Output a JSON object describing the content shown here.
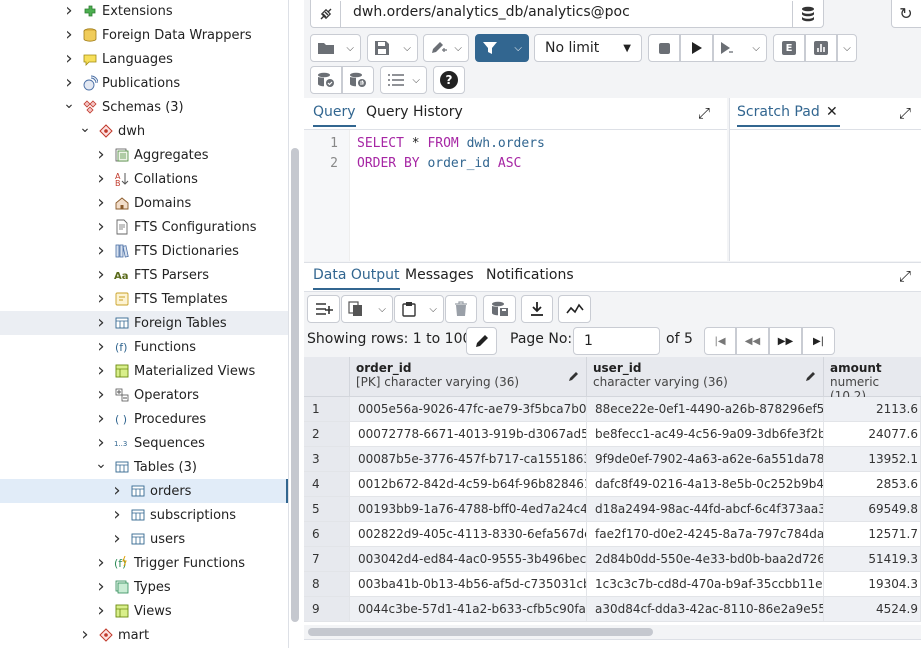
{
  "tree": {
    "items": [
      {
        "label": "Extensions",
        "count": ""
      },
      {
        "label": "Foreign Data Wrappers",
        "count": ""
      },
      {
        "label": "Languages",
        "count": ""
      },
      {
        "label": "Publications",
        "count": ""
      },
      {
        "label": "Schemas",
        "count": "(3)"
      },
      {
        "label": "dwh",
        "count": ""
      },
      {
        "label": "Aggregates",
        "count": ""
      },
      {
        "label": "Collations",
        "count": ""
      },
      {
        "label": "Domains",
        "count": ""
      },
      {
        "label": "FTS Configurations",
        "count": ""
      },
      {
        "label": "FTS Dictionaries",
        "count": ""
      },
      {
        "label": "FTS Parsers",
        "count": ""
      },
      {
        "label": "FTS Templates",
        "count": ""
      },
      {
        "label": "Foreign Tables",
        "count": ""
      },
      {
        "label": "Functions",
        "count": ""
      },
      {
        "label": "Materialized Views",
        "count": ""
      },
      {
        "label": "Operators",
        "count": ""
      },
      {
        "label": "Procedures",
        "count": ""
      },
      {
        "label": "Sequences",
        "count": ""
      },
      {
        "label": "Tables",
        "count": "(3)"
      },
      {
        "label": "orders",
        "count": ""
      },
      {
        "label": "subscriptions",
        "count": ""
      },
      {
        "label": "users",
        "count": ""
      },
      {
        "label": "Trigger Functions",
        "count": ""
      },
      {
        "label": "Types",
        "count": ""
      },
      {
        "label": "Views",
        "count": ""
      },
      {
        "label": "mart",
        "count": ""
      }
    ]
  },
  "connection": {
    "label": "dwh.orders/analytics_db/analytics@poc"
  },
  "toolbar": {
    "limit": "No limit"
  },
  "editor_tabs": {
    "query": "Query",
    "history": "Query History",
    "scratch": "Scratch Pad"
  },
  "sql": {
    "line_numbers": [
      "1",
      "2"
    ],
    "l1": {
      "kw1": "SELECT",
      "star": " * ",
      "kw2": "FROM",
      "sp": " ",
      "tbl": "dwh.orders"
    },
    "l2": {
      "kw1": "ORDER BY",
      "sp": " ",
      "col": "order_id",
      "sp2": " ",
      "kw2": "ASC"
    }
  },
  "output_tabs": {
    "data": "Data Output",
    "messages": "Messages",
    "notifications": "Notifications"
  },
  "pager": {
    "showing": "Showing rows: 1 to 1000",
    "page_label": "Page No:",
    "page": "1",
    "of": "of 5"
  },
  "columns": [
    {
      "name": "order_id",
      "type": "[PK] character varying (36)"
    },
    {
      "name": "user_id",
      "type": "character varying (36)"
    },
    {
      "name": "amount",
      "type": "numeric (10,2)"
    }
  ],
  "rows": [
    {
      "n": "1",
      "order_id": "0005e56a-9026-47fc-ae79-3f5bca7b0...",
      "user_id": "88ece22e-0ef1-4490-a26b-878296ef5...",
      "amount": "2113.6"
    },
    {
      "n": "2",
      "order_id": "00072778-6671-4013-919b-d3067ad5...",
      "user_id": "be8fecc1-ac49-4c56-9a09-3db6fe3f2b...",
      "amount": "24077.6"
    },
    {
      "n": "3",
      "order_id": "00087b5e-3776-457f-b717-ca1551863...",
      "user_id": "9f9de0ef-7902-4a63-a62e-6a551da78...",
      "amount": "13952.1"
    },
    {
      "n": "4",
      "order_id": "0012b672-842d-4c59-b64f-96b828461...",
      "user_id": "dafc8f49-0216-4a13-8e5b-0c252b9b4...",
      "amount": "2853.6"
    },
    {
      "n": "5",
      "order_id": "00193bb9-1a76-4788-bff0-4ed7a24c4...",
      "user_id": "d18a2494-98ac-44fd-abcf-6c4f373aa3...",
      "amount": "69549.8"
    },
    {
      "n": "6",
      "order_id": "002822d9-405c-4113-8330-6efa567de...",
      "user_id": "fae2f170-d0e2-4245-8a7a-797c784da...",
      "amount": "12571.7"
    },
    {
      "n": "7",
      "order_id": "003042d4-ed84-4ac0-9555-3b496becf...",
      "user_id": "2d84b0dd-550e-4e33-bd0b-baa2d726...",
      "amount": "51419.3"
    },
    {
      "n": "8",
      "order_id": "003ba41b-0b13-4b56-af5d-c735031cb...",
      "user_id": "1c3c3c7b-cd8d-470a-b9af-35ccbb11e...",
      "amount": "19304.3"
    },
    {
      "n": "9",
      "order_id": "0044c3be-57d1-41a2-b633-cfb5c90fa...",
      "user_id": "a30d84cf-dda3-42ac-8110-86e2a9e55...",
      "amount": "4524.9"
    }
  ]
}
